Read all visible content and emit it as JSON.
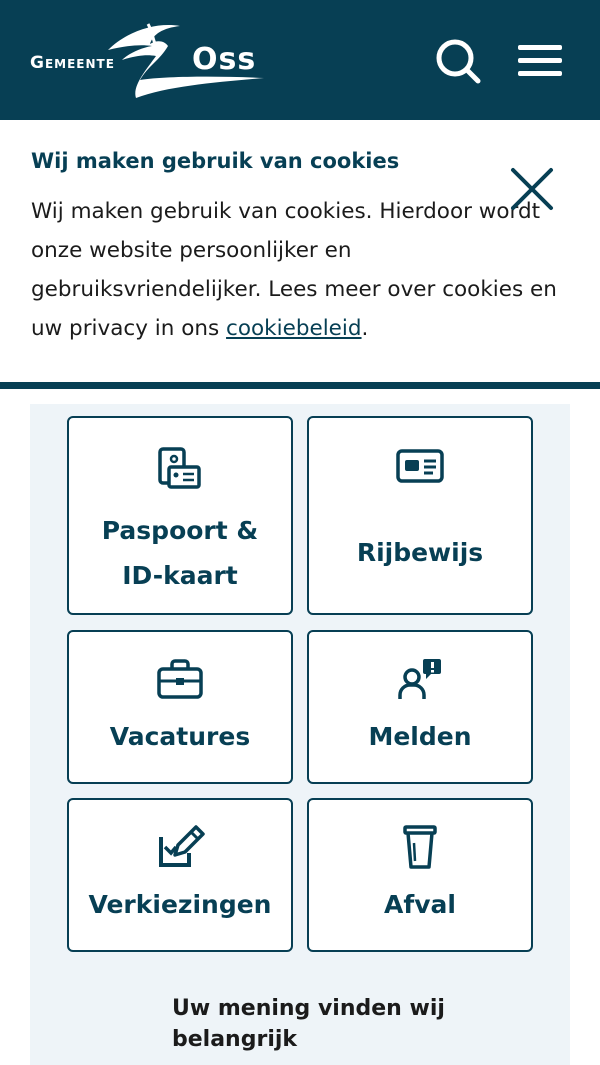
{
  "header": {
    "logo_word_left": "Gemeente",
    "logo_word_right": "Oss",
    "background_color": "#073f54",
    "search_icon": "search-icon",
    "menu_icon": "hamburger-menu-icon"
  },
  "cookie_banner": {
    "title": "Wij maken gebruik van cookies",
    "text_before_link": "Wij maken gebruik van cookies. Hierdoor wordt onze website persoonlijker en gebruiksvriendelijker. Lees meer over cookies en uw privacy in ons ",
    "link_text": "cookiebeleid",
    "text_after_link": ".",
    "close_icon": "close-icon"
  },
  "tiles": [
    {
      "label": "Paspoort & ID-kaart",
      "icon": "passport-id-icon"
    },
    {
      "label": "Rijbewijs",
      "icon": "driving-license-icon"
    },
    {
      "label": "Vacatures",
      "icon": "briefcase-icon"
    },
    {
      "label": "Melden",
      "icon": "report-person-icon"
    },
    {
      "label": "Verkiezingen",
      "icon": "ballot-pencil-icon"
    },
    {
      "label": "Afval",
      "icon": "waste-bin-icon"
    }
  ],
  "feedback": {
    "heading": "Uw mening vinden wij belangrijk"
  },
  "colors": {
    "primary": "#073f54",
    "panel_background": "#eef4f8"
  }
}
